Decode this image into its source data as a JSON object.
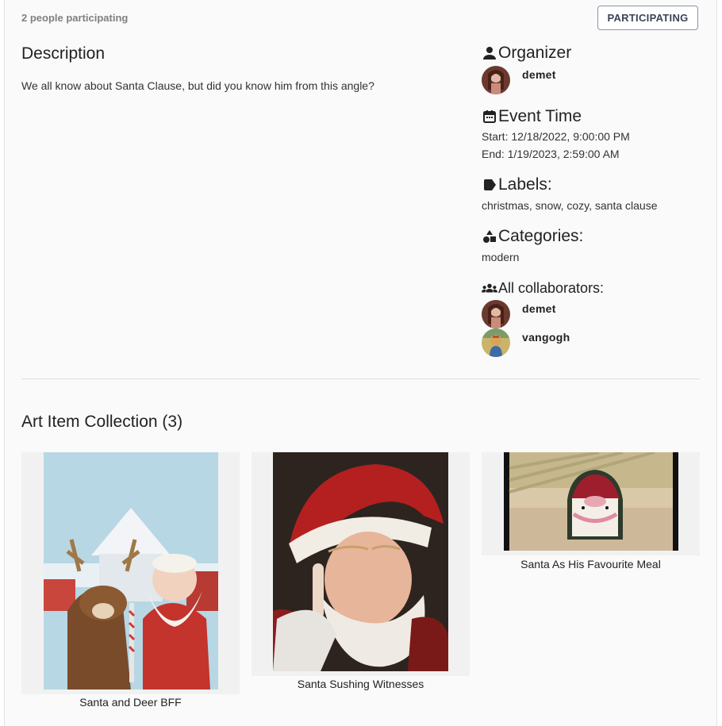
{
  "header": {
    "participants": "2 people participating",
    "participate_button": "PARTICIPATING"
  },
  "description": {
    "heading": "Description",
    "text": "We all know about Santa Clause, but did you know him from this angle?"
  },
  "organizer": {
    "heading": "Organizer",
    "name": "demet"
  },
  "event_time": {
    "heading": "Event Time",
    "start": "Start: 12/18/2022, 9:00:00 PM",
    "end": "End: 1/19/2023, 2:59:00 AM"
  },
  "labels": {
    "heading": "Labels:",
    "value": "christmas, snow, cozy, santa clause"
  },
  "categories": {
    "heading": "Categories:",
    "value": "modern"
  },
  "collaborators": {
    "heading": "All collaborators:",
    "items": [
      {
        "name": "demet"
      },
      {
        "name": "vangogh"
      }
    ]
  },
  "collection": {
    "heading": "Art Item Collection (3)",
    "items": [
      {
        "title": "Santa and Deer BFF"
      },
      {
        "title": "Santa Sushing Witnesses"
      },
      {
        "title": "Santa As His Favourite Meal"
      }
    ]
  },
  "icons": {
    "organizer": "person-icon",
    "event_time": "calendar-icon",
    "labels": "label-icon",
    "categories": "shapes-icon",
    "collaborators": "group-icon"
  }
}
